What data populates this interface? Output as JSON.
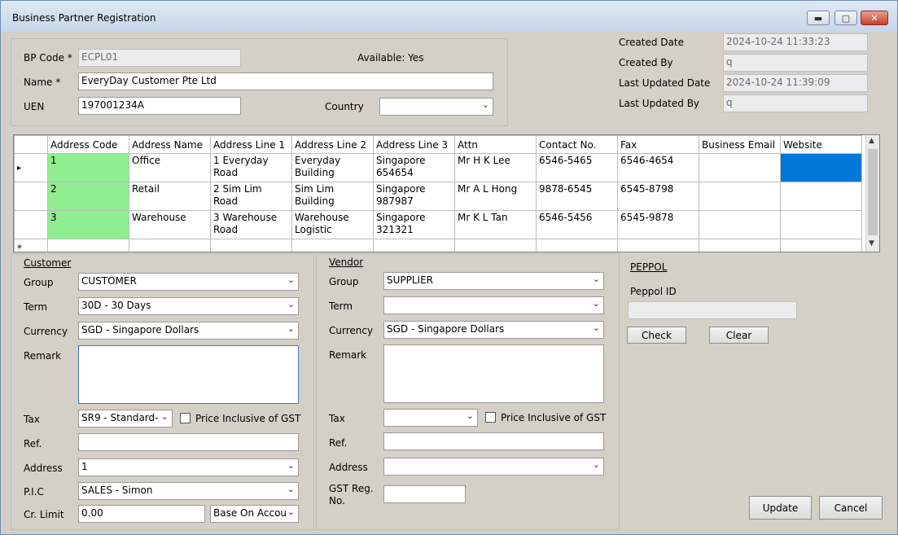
{
  "window": {
    "title": "Business Partner Registration"
  },
  "header": {
    "bp_code_label": "BP Code *",
    "bp_code_value": "ECPL01",
    "available_text": "Available: Yes",
    "name_label": "Name *",
    "name_value": "EveryDay Customer Pte Ltd",
    "uen_label": "UEN",
    "uen_value": "197001234A",
    "country_label": "Country",
    "country_value": ""
  },
  "audit": {
    "created_date_label": "Created Date",
    "created_date_value": "2024-10-24 11:33:23",
    "created_by_label": "Created By",
    "created_by_value": "q",
    "last_updated_date_label": "Last Updated Date",
    "last_updated_date_value": "2024-10-24 11:39:09",
    "last_updated_by_label": "Last Updated By",
    "last_updated_by_value": "q"
  },
  "grid": {
    "columns": [
      "Address Code",
      "Address Name",
      "Address Line 1",
      "Address Line 2",
      "Address Line 3",
      "Attn",
      "Contact No.",
      "Fax",
      "Business Email",
      "Website"
    ],
    "rows": [
      [
        "1",
        "Office",
        "1 Everyday Road",
        "Everyday Building",
        "Singapore 654654",
        "Mr H K Lee",
        "6546-5465",
        "6546-4654",
        "",
        ""
      ],
      [
        "2",
        "Retail",
        "2 Sim Lim Road",
        "Sim Lim Building",
        "Singapore 987987",
        "Mr A L Hong",
        "9878-6545",
        "6545-8798",
        "",
        ""
      ],
      [
        "3",
        "Warehouse",
        "3 Warehouse Road",
        "Warehouse Logistic",
        "Singapore 321321",
        "Mr K L Tan",
        "6546-5456",
        "6545-9878",
        "",
        ""
      ]
    ],
    "current_row_marker": "▸",
    "new_row_marker": "*"
  },
  "customer": {
    "section_title": "Customer",
    "group_label": "Group",
    "group_value": "CUSTOMER",
    "term_label": "Term",
    "term_value": "30D - 30 Days",
    "currency_label": "Currency",
    "currency_value": "SGD - Singapore Dollars",
    "remark_label": "Remark",
    "remark_value": "",
    "tax_label": "Tax",
    "tax_value": "SR9 - Standard-",
    "price_incl_label": "Price Inclusive of GST",
    "ref_label": "Ref.",
    "ref_value": "",
    "address_label": "Address",
    "address_value": "1",
    "pic_label": "P.I.C",
    "pic_value": "SALES - Simon",
    "cr_limit_label": "Cr. Limit",
    "cr_limit_value": "0.00",
    "cr_basis_value": "Base On Accou"
  },
  "vendor": {
    "section_title": "Vendor",
    "group_label": "Group",
    "group_value": "SUPPLIER",
    "term_label": "Term",
    "term_value": "",
    "currency_label": "Currency",
    "currency_value": "SGD - Singapore Dollars",
    "remark_label": "Remark",
    "remark_value": "",
    "tax_label": "Tax",
    "tax_value": "",
    "price_incl_label": "Price Inclusive of GST",
    "ref_label": "Ref.",
    "ref_value": "",
    "address_label": "Address",
    "address_value": "",
    "gst_reg_label": "GST Reg. No.",
    "gst_reg_value": ""
  },
  "peppol": {
    "section_title": "PEPPOL",
    "id_label": "Peppol ID",
    "id_value": "",
    "check_label": "Check",
    "clear_label": "Clear"
  },
  "actions": {
    "update_label": "Update",
    "cancel_label": "Cancel"
  },
  "colors": {
    "address_code_bg": "#90ee90",
    "selected_cell": "#0078d7",
    "form_bg": "#d4d0c8"
  },
  "icons": {
    "minimize": "minimize-icon",
    "maximize": "maximize-icon",
    "close": "close-icon",
    "dropdown": "chevron-down-icon"
  }
}
